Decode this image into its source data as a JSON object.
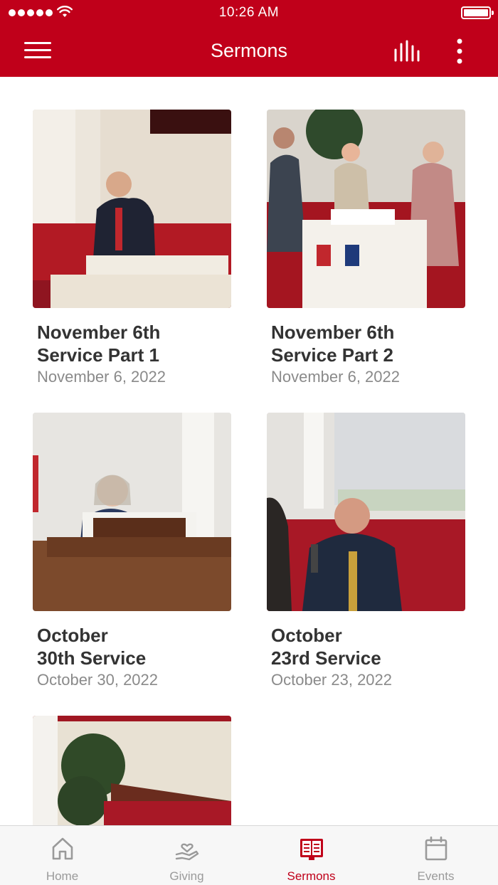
{
  "status_bar": {
    "time": "10:26 AM"
  },
  "header": {
    "title": "Sermons"
  },
  "sermons": [
    {
      "title_line1": "November 6th",
      "title_line2": "Service Part 1",
      "date": "November 6, 2022"
    },
    {
      "title_line1": "November 6th",
      "title_line2": "Service Part 2",
      "date": "November 6, 2022"
    },
    {
      "title_line1": "October",
      "title_line2": "30th Service",
      "date": "October 30, 2022"
    },
    {
      "title_line1": "October",
      "title_line2": "23rd Service",
      "date": "October 23, 2022"
    }
  ],
  "tabs": [
    {
      "label": "Home",
      "icon": "home-icon"
    },
    {
      "label": "Giving",
      "icon": "giving-icon"
    },
    {
      "label": "Sermons",
      "icon": "sermons-book-icon"
    },
    {
      "label": "Events",
      "icon": "calendar-icon"
    }
  ],
  "colors": {
    "brand": "#c0001a",
    "active_tab": "#c0001a",
    "inactive_tab": "#9a9a9a"
  }
}
